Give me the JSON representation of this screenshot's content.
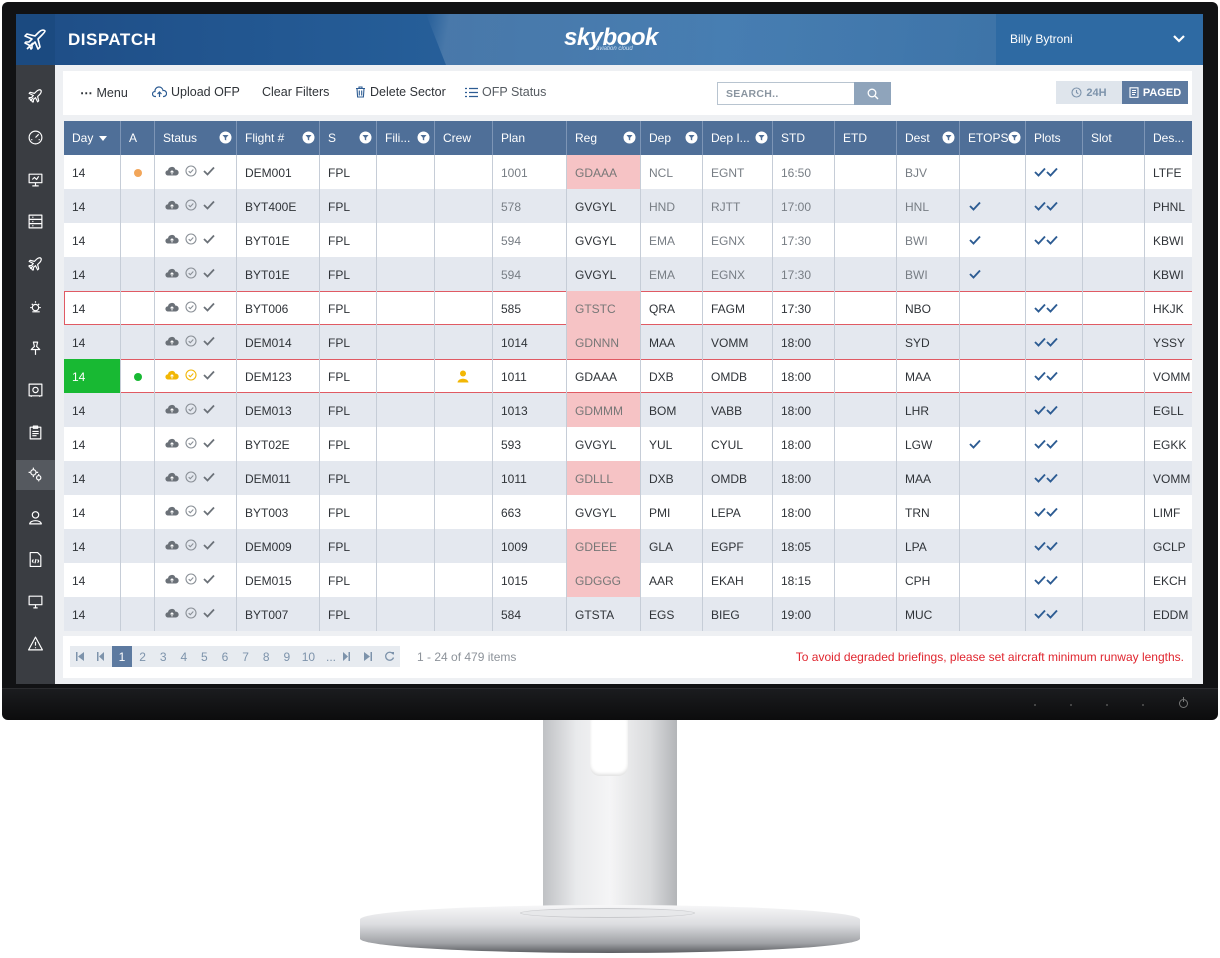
{
  "header": {
    "app_title": "DISPATCH",
    "brand": "skybook",
    "brand_sub": "aviation cloud",
    "user_name": "Billy Bytroni"
  },
  "sidebar": {
    "items": [
      {
        "icon": "plane-crossed-icon"
      },
      {
        "icon": "gauge-icon"
      },
      {
        "icon": "presentation-icon"
      },
      {
        "icon": "list-board-icon"
      },
      {
        "icon": "plane-settings-icon"
      },
      {
        "icon": "weather-icon"
      },
      {
        "icon": "pin-icon"
      },
      {
        "icon": "safe-icon"
      },
      {
        "icon": "clipboard-icon"
      },
      {
        "icon": "gears-icon",
        "active": true
      },
      {
        "icon": "user-icon"
      },
      {
        "icon": "code-file-icon"
      },
      {
        "icon": "monitor-icon"
      },
      {
        "icon": "warning-icon"
      }
    ]
  },
  "toolbar": {
    "menu": "Menu",
    "upload": "Upload OFP",
    "clear": "Clear Filters",
    "delete": "Delete Sector",
    "ofp_status": "OFP Status",
    "search_placeholder": "SEARCH..",
    "view_24h": "24H",
    "view_paged": "PAGED"
  },
  "columns": [
    "Day",
    "A",
    "Status",
    "Flight #",
    "S",
    "Fili...",
    "Crew",
    "Plan",
    "Reg",
    "Dep",
    "Dep I...",
    "STD",
    "ETD",
    "Dest",
    "ETOPS",
    "Plots",
    "Slot",
    "Des..."
  ],
  "rows": [
    {
      "day": "14",
      "alert": "orange",
      "status": "grey",
      "flight": "DEM001",
      "s": "FPL",
      "plan": "1001",
      "reg": "GDAAA",
      "reg_hl": true,
      "dep": "NCL",
      "dep_icao": "EGNT",
      "std": "16:50",
      "dest": "BJV",
      "etops": false,
      "plots": true,
      "dest_icao": "LTFE",
      "faded": true
    },
    {
      "day": "14",
      "alert": "",
      "status": "grey",
      "flight": "BYT400E",
      "s": "FPL",
      "plan": "578",
      "reg": "GVGYL",
      "reg_hl": false,
      "dep": "HND",
      "dep_icao": "RJTT",
      "std": "17:00",
      "dest": "HNL",
      "etops": true,
      "plots": true,
      "dest_icao": "PHNL",
      "faded": true
    },
    {
      "day": "14",
      "alert": "",
      "status": "grey",
      "flight": "BYT01E",
      "s": "FPL",
      "plan": "594",
      "reg": "GVGYL",
      "reg_hl": false,
      "dep": "EMA",
      "dep_icao": "EGNX",
      "std": "17:30",
      "dest": "BWI",
      "etops": true,
      "plots": true,
      "dest_icao": "KBWI",
      "faded": true
    },
    {
      "day": "14",
      "alert": "",
      "status": "grey",
      "flight": "BYT01E",
      "s": "FPL",
      "plan": "594",
      "reg": "GVGYL",
      "reg_hl": false,
      "dep": "EMA",
      "dep_icao": "EGNX",
      "std": "17:30",
      "dest": "BWI",
      "etops": true,
      "plots": false,
      "dest_icao": "KBWI",
      "faded": true
    },
    {
      "day": "14",
      "alert": "",
      "status": "grey",
      "flight": "BYT006",
      "s": "FPL",
      "plan": "585",
      "reg": "GTSTC",
      "reg_hl": true,
      "dep": "QRA",
      "dep_icao": "FAGM",
      "std": "17:30",
      "dest": "NBO",
      "etops": false,
      "plots": true,
      "dest_icao": "HKJK",
      "faded": false,
      "outlined": true
    },
    {
      "day": "14",
      "alert": "",
      "status": "grey",
      "flight": "DEM014",
      "s": "FPL",
      "plan": "1014",
      "reg": "GDNNN",
      "reg_hl": true,
      "dep": "MAA",
      "dep_icao": "VOMM",
      "std": "18:00",
      "dest": "SYD",
      "etops": false,
      "plots": true,
      "dest_icao": "YSSY",
      "faded": false
    },
    {
      "day": "14",
      "alert": "green",
      "status": "yellow",
      "flight": "DEM123",
      "s": "FPL",
      "crew": true,
      "plan": "1011",
      "reg": "GDAAA",
      "reg_hl": false,
      "dep": "DXB",
      "dep_icao": "OMDB",
      "std": "18:00",
      "dest": "MAA",
      "etops": false,
      "plots": true,
      "dest_icao": "VOMM",
      "faded": false,
      "outlined": true,
      "day_green": true
    },
    {
      "day": "14",
      "alert": "",
      "status": "grey",
      "flight": "DEM013",
      "s": "FPL",
      "plan": "1013",
      "reg": "GDMMM",
      "reg_hl": true,
      "dep": "BOM",
      "dep_icao": "VABB",
      "std": "18:00",
      "dest": "LHR",
      "etops": false,
      "plots": true,
      "dest_icao": "EGLL",
      "faded": false
    },
    {
      "day": "14",
      "alert": "",
      "status": "grey",
      "flight": "BYT02E",
      "s": "FPL",
      "plan": "593",
      "reg": "GVGYL",
      "reg_hl": false,
      "dep": "YUL",
      "dep_icao": "CYUL",
      "std": "18:00",
      "dest": "LGW",
      "etops": true,
      "plots": true,
      "dest_icao": "EGKK",
      "faded": false
    },
    {
      "day": "14",
      "alert": "",
      "status": "grey",
      "flight": "DEM011",
      "s": "FPL",
      "plan": "1011",
      "reg": "GDLLL",
      "reg_hl": true,
      "dep": "DXB",
      "dep_icao": "OMDB",
      "std": "18:00",
      "dest": "MAA",
      "etops": false,
      "plots": true,
      "dest_icao": "VOMM",
      "faded": false
    },
    {
      "day": "14",
      "alert": "",
      "status": "grey",
      "flight": "BYT003",
      "s": "FPL",
      "plan": "663",
      "reg": "GVGYL",
      "reg_hl": false,
      "dep": "PMI",
      "dep_icao": "LEPA",
      "std": "18:00",
      "dest": "TRN",
      "etops": false,
      "plots": true,
      "dest_icao": "LIMF",
      "faded": false
    },
    {
      "day": "14",
      "alert": "",
      "status": "grey",
      "flight": "DEM009",
      "s": "FPL",
      "plan": "1009",
      "reg": "GDEEE",
      "reg_hl": true,
      "dep": "GLA",
      "dep_icao": "EGPF",
      "std": "18:05",
      "dest": "LPA",
      "etops": false,
      "plots": true,
      "dest_icao": "GCLP",
      "faded": false
    },
    {
      "day": "14",
      "alert": "",
      "status": "grey",
      "flight": "DEM015",
      "s": "FPL",
      "plan": "1015",
      "reg": "GDGGG",
      "reg_hl": true,
      "dep": "AAR",
      "dep_icao": "EKAH",
      "std": "18:15",
      "dest": "CPH",
      "etops": false,
      "plots": true,
      "dest_icao": "EKCH",
      "faded": false
    },
    {
      "day": "14",
      "alert": "",
      "status": "grey",
      "flight": "BYT007",
      "s": "FPL",
      "plan": "584",
      "reg": "GTSTA",
      "reg_hl": false,
      "dep": "EGS",
      "dep_icao": "BIEG",
      "std": "19:00",
      "dest": "MUC",
      "etops": false,
      "plots": true,
      "dest_icao": "EDDM",
      "faded": false
    }
  ],
  "pager": {
    "pages": [
      "1",
      "2",
      "3",
      "4",
      "5",
      "6",
      "7",
      "8",
      "9",
      "10",
      "..."
    ],
    "current": "1",
    "info": "1 - 24 of 479 items",
    "warning": "To avoid degraded briefings, please set aircraft minimum runway lengths."
  },
  "colors": {
    "header_blue": "#2b6aa6",
    "grid_header": "#4f6f98",
    "reg_highlight": "#f6c3c5",
    "day_green": "#18b933",
    "tick_blue": "#2d5c93",
    "warning_red": "#e0262f"
  }
}
